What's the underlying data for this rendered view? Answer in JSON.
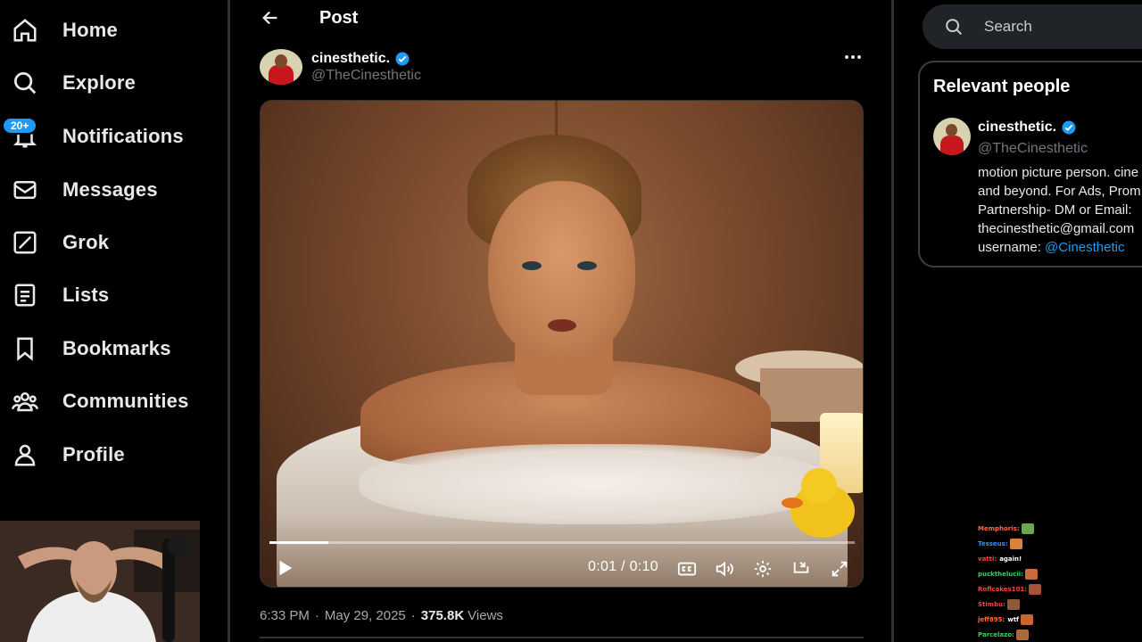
{
  "nav": {
    "items": [
      {
        "label": "Home"
      },
      {
        "label": "Explore"
      },
      {
        "label": "Notifications",
        "badge": "20+"
      },
      {
        "label": "Messages"
      },
      {
        "label": "Grok"
      },
      {
        "label": "Lists"
      },
      {
        "label": "Bookmarks"
      },
      {
        "label": "Communities"
      },
      {
        "label": "Profile"
      }
    ]
  },
  "header": {
    "title": "Post"
  },
  "post": {
    "author_name": "cinesthetic.",
    "author_handle": "@TheCinesthetic",
    "video": {
      "time_display": "0:01 / 0:10",
      "progress": 0.1
    },
    "time": "6:33 PM",
    "date": "May 29, 2025",
    "views_count": "375.8K",
    "views_label": "Views"
  },
  "search": {
    "placeholder": "Search"
  },
  "relevant": {
    "title": "Relevant people",
    "name": "cinesthetic.",
    "handle": "@TheCinesthetic",
    "bio_lines": [
      "motion picture person. cine",
      "and beyond. For Ads, Prom",
      "Partnership- DM or Email:",
      "thecinesthetic@gmail.com"
    ],
    "bio_last_prefix": "username: ",
    "bio_last_mention": "@Cinesthetic"
  },
  "chat": [
    {
      "user": "Memphoris:",
      "msg": "",
      "color": "#ff6a3d"
    },
    {
      "user": "Tesseus:",
      "msg": "",
      "color": "#3d8bff"
    },
    {
      "user": "vatti:",
      "msg": "again!",
      "color": "#ff4040"
    },
    {
      "user": "puckthelucii:",
      "msg": "",
      "color": "#39d353"
    },
    {
      "user": "Roflcakes101:",
      "msg": "",
      "color": "#ff4040"
    },
    {
      "user": "Stimbu:",
      "msg": "",
      "color": "#ff4040"
    },
    {
      "user": "jeff895:",
      "msg": "wtf",
      "color": "#ff6a3d"
    },
    {
      "user": "Parcelazo:",
      "msg": "",
      "color": "#39d353"
    }
  ],
  "colors": {
    "accent": "#1d9bf0",
    "background": "#000000",
    "muted": "#71767b"
  }
}
